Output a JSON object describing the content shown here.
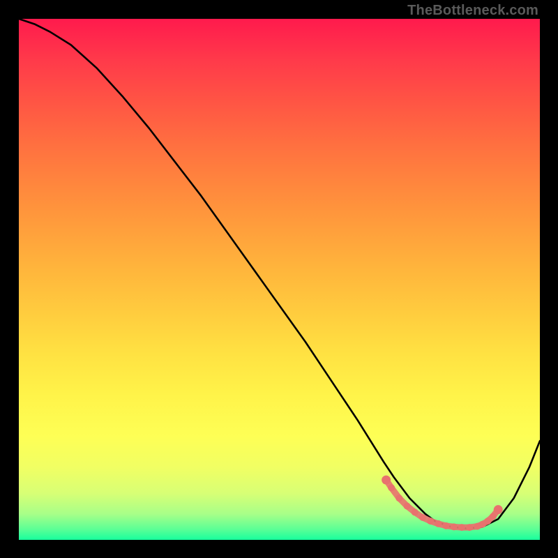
{
  "watermark": "TheBottleneck.com",
  "chart_data": {
    "type": "line",
    "title": "",
    "xlabel": "",
    "ylabel": "",
    "xlim": [
      0,
      100
    ],
    "ylim": [
      0,
      100
    ],
    "grid": false,
    "legend": false,
    "series": [
      {
        "name": "curve",
        "color": "#000000",
        "x": [
          0,
          3,
          6,
          10,
          15,
          20,
          25,
          30,
          35,
          40,
          45,
          50,
          55,
          60,
          65,
          70,
          72,
          75,
          78,
          80,
          83,
          86,
          89,
          92,
          95,
          98,
          100
        ],
        "y": [
          100,
          99,
          97.5,
          95,
          90.5,
          85,
          79,
          72.5,
          66,
          59,
          52,
          45,
          38,
          30.5,
          23,
          15,
          12,
          8,
          5,
          3.5,
          2.5,
          2.2,
          2.5,
          4,
          8,
          14,
          19
        ]
      }
    ],
    "markers": {
      "name": "bottleneck-zone",
      "color": "#e8726e",
      "x": [
        70.5,
        71.5,
        73,
        74.5,
        76,
        77.5,
        79,
        80.5,
        82,
        83.5,
        85,
        86.5,
        88,
        89,
        90,
        91,
        92
      ],
      "y": [
        11.5,
        10,
        8,
        6.5,
        5.3,
        4.3,
        3.6,
        3.1,
        2.7,
        2.5,
        2.4,
        2.4,
        2.6,
        3.0,
        3.6,
        4.5,
        5.8
      ]
    },
    "background_gradient": {
      "top": "#ff1a4d",
      "mid": "#ffe142",
      "bottom": "#18ff9d"
    }
  }
}
